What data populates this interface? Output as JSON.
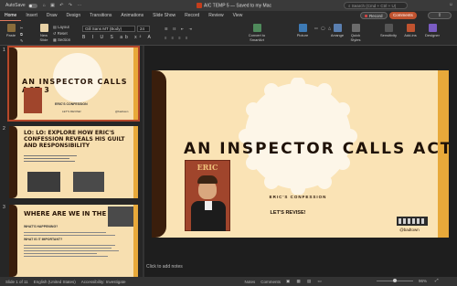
{
  "titlebar": {
    "autosave": "AutoSave",
    "doc_title": "AIC TEMP 5 — Saved to my Mac",
    "search_placeholder": "Search (Cmd + Ctrl + U)"
  },
  "tabs": [
    "Home",
    "Insert",
    "Draw",
    "Design",
    "Transitions",
    "Animations",
    "Slide Show",
    "Record",
    "Review",
    "View"
  ],
  "actions": {
    "record": "Record",
    "comments": "Comments",
    "share": ""
  },
  "ribbon": {
    "paste": "Paste",
    "new_slide": "New Slide",
    "layout": "Layout",
    "reset": "Reset",
    "section": "Section",
    "font": "Gill Sans MT (Body)",
    "font_size": "24",
    "convert_smartart": "Convert to SmartArt",
    "picture": "Picture",
    "arrange": "Arrange",
    "quick_styles": "Quick Styles",
    "sensitivity": "Sensitivity",
    "addins": "Add-ins",
    "designer": "Designer"
  },
  "thumbnails": [
    {
      "num": "1",
      "title": "AN INSPECTOR CALLS ACT 3",
      "sub": "ERIC'S CONFESSION",
      "revise": "LET'S REVISE!",
      "handle": "@badtown"
    },
    {
      "num": "2",
      "title": "LO: LO: EXPLORE HOW ERIC'S CONFESSION REVEALS HIS GUILT AND RESPONSIBILITY"
    },
    {
      "num": "3",
      "title": "WHERE ARE WE IN THE PLAY?",
      "sub": "WHAT'S HAPPENING?",
      "sub2": "WHAT IS IT IMPORTANT?"
    }
  ],
  "slide": {
    "title": "AN INSPECTOR CALLS ACT 3",
    "subtitle": "ERIC'S CONFESSION",
    "revise": "LET'S REVISE!",
    "handle": "@badtown",
    "poster_text": "ERIC"
  },
  "notes_placeholder": "Click to add notes",
  "status": {
    "slide_count": "Slide 1 of 11",
    "language": "English (United States)",
    "accessibility": "Accessibility: Investigate",
    "notes": "Notes",
    "comments": "Comments",
    "zoom": "96%"
  },
  "colors": {
    "accent": "#c0532f",
    "slide_bg": "#fae3b5",
    "curtain": "#3a1e0c",
    "gold": "#e8a93a"
  }
}
